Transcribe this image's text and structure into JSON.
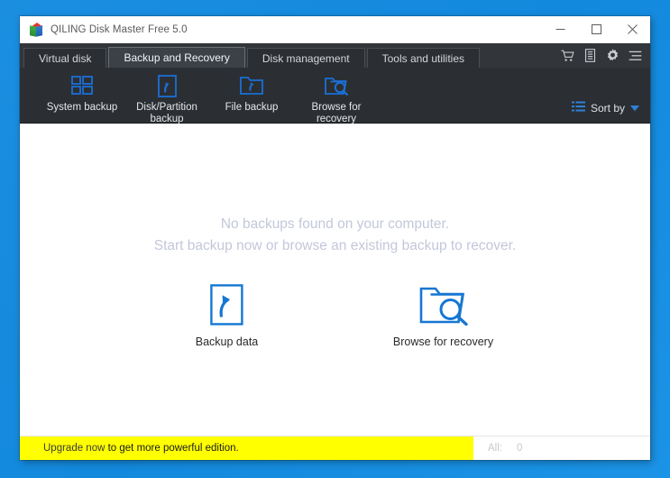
{
  "window": {
    "title": "QILING Disk Master Free 5.0",
    "logo_icon": "qiling-cube-logo",
    "controls": {
      "minimize": "minimize-icon",
      "maximize": "maximize-icon",
      "close": "close-icon"
    }
  },
  "tabs": [
    {
      "label": "Virtual disk",
      "active": false
    },
    {
      "label": "Backup and Recovery",
      "active": true
    },
    {
      "label": "Disk management",
      "active": false
    },
    {
      "label": "Tools and utilities",
      "active": false
    }
  ],
  "tab_tools": [
    {
      "name": "cart-icon",
      "title": "Buy"
    },
    {
      "name": "log-icon",
      "title": "Logs"
    },
    {
      "name": "gear-icon",
      "title": "Settings"
    },
    {
      "name": "menu-icon",
      "title": "Menu"
    }
  ],
  "toolbar": {
    "items": [
      {
        "icon": "system-backup-icon",
        "label": "System backup"
      },
      {
        "icon": "disk-partition-backup-icon",
        "label": "Disk/Partition\nbackup"
      },
      {
        "icon": "file-backup-icon",
        "label": "File backup"
      },
      {
        "icon": "browse-for-recovery-icon",
        "label": "Browse for\nrecovery"
      }
    ],
    "sort": {
      "icon": "sort-list-icon",
      "label": "Sort by",
      "caret": "chevron-down-icon"
    }
  },
  "content": {
    "empty_state": {
      "line1": "No backups found on your computer.",
      "line2": "Start backup now or browse an existing backup to recover."
    },
    "actions": [
      {
        "icon": "backup-data-icon",
        "label": "Backup data"
      },
      {
        "icon": "browse-recovery-icon",
        "label": "Browse for recovery"
      }
    ]
  },
  "status_bar": {
    "upgrade_link": "Upgrade now",
    "upgrade_rest": " to get more powerful edition.",
    "filter_label": "All:",
    "filter_count": "0"
  },
  "colors": {
    "desktop": "#1b8ee0",
    "toolbar_bg": "#2b2f33",
    "tabstrip_bg": "#32363b",
    "active_tab_bg": "#3c4147",
    "accent_blue": "#1677d2",
    "banner_yellow": "#ffff00",
    "empty_text": "#c3c7da"
  }
}
